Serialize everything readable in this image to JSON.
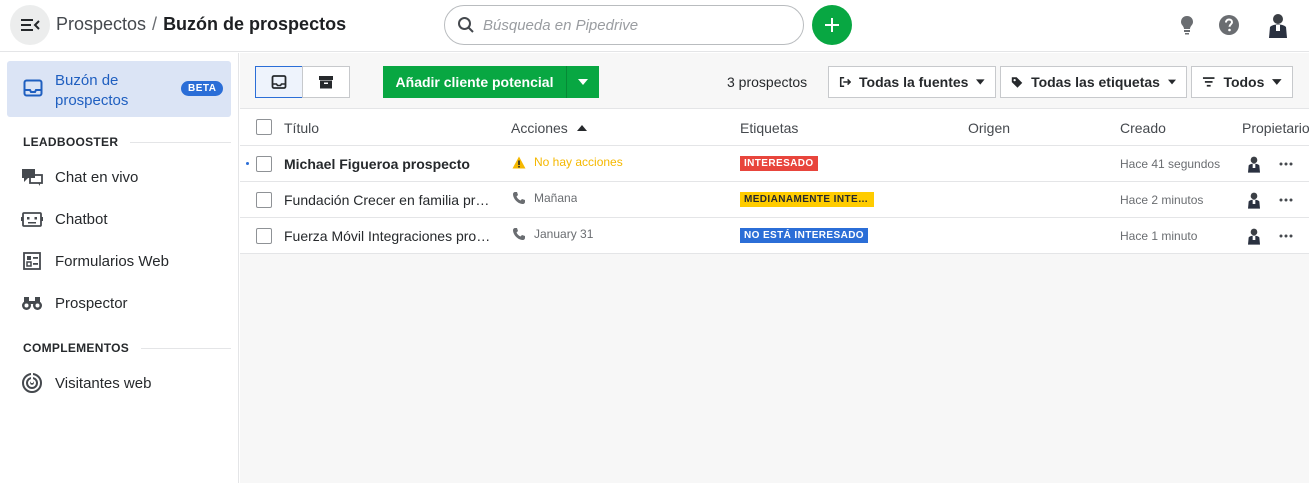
{
  "header": {
    "breadcrumb_parent": "Prospectos",
    "breadcrumb_sep": "/",
    "breadcrumb_current": "Buzón de prospectos",
    "search_placeholder": "Búsqueda en Pipedrive"
  },
  "sidebar": {
    "active_label": "Buzón de prospectos",
    "active_badge": "BETA",
    "section_leadbooster": "LEADBOOSTER",
    "section_complementos": "COMPLEMENTOS",
    "items": [
      {
        "label": "Chat en vivo",
        "icon": "chat-icon"
      },
      {
        "label": "Chatbot",
        "icon": "chatbot-icon"
      },
      {
        "label": "Formularios Web",
        "icon": "form-icon"
      },
      {
        "label": "Prospector",
        "icon": "binoculars-icon"
      },
      {
        "label": "Visitantes web",
        "icon": "radar-icon"
      }
    ]
  },
  "toolbar": {
    "add_label": "Añadir cliente potencial",
    "count": "3 prospectos",
    "filter_sources": "Todas la fuentes",
    "filter_tags": "Todas las etiquetas",
    "filter_owner": "Todos"
  },
  "table": {
    "headers": [
      "Título",
      "Acciones",
      "Etiquetas",
      "Origen",
      "Creado",
      "Propietario"
    ],
    "rows": [
      {
        "title": "Michael Figueroa prospecto",
        "action": "No hay acciones",
        "tag": "INTERESADO",
        "tag_color": "#e8453c",
        "created": "Hace 41 segundos"
      },
      {
        "title": "Fundación Crecer en familia prospecto",
        "action": "Mañana",
        "tag": "MEDIANAMENTE INTERESADO",
        "tag_color": "#ffcc00",
        "created": "Hace 2 minutos"
      },
      {
        "title": "Fuerza Móvil Integraciones prospecto",
        "action": "January 31",
        "tag": "NO ESTÁ INTERESADO",
        "tag_color": "#2b6ed7",
        "created": "Hace 1 minuto"
      }
    ]
  },
  "colors": {
    "accent_green": "#08a742",
    "accent_blue": "#2b6ed7"
  }
}
